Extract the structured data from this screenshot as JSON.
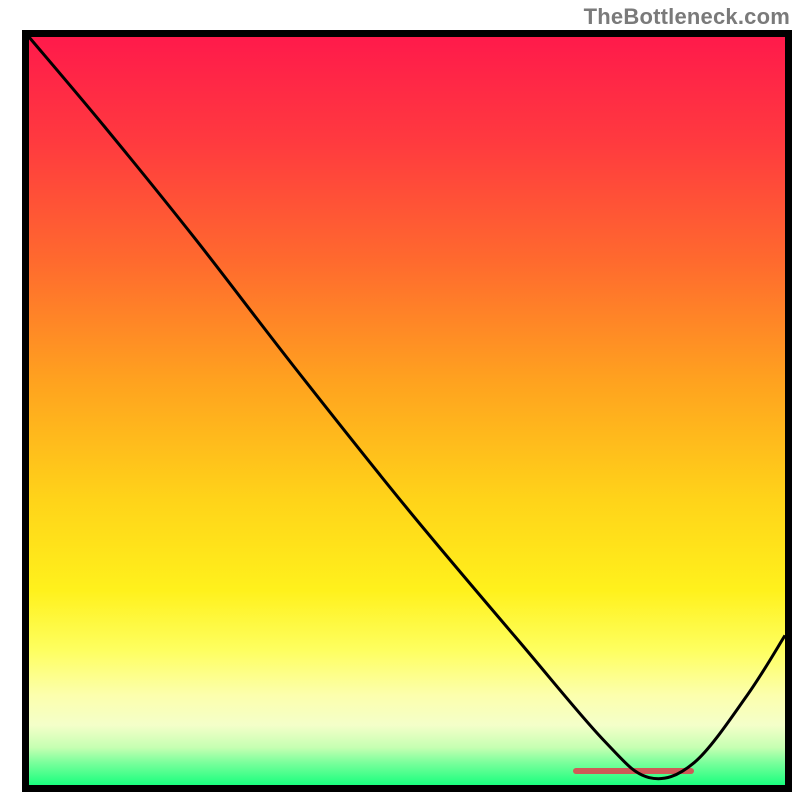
{
  "watermark": "TheBottleneck.com",
  "colors": {
    "frame_border": "#000000",
    "curve_stroke": "#000000",
    "marker": "#cf5a57"
  },
  "gradient": {
    "stops": [
      {
        "pct": 0,
        "color": "#ff1a4b"
      },
      {
        "pct": 14,
        "color": "#ff3a3f"
      },
      {
        "pct": 30,
        "color": "#ff6a2e"
      },
      {
        "pct": 46,
        "color": "#ffa21f"
      },
      {
        "pct": 62,
        "color": "#ffd419"
      },
      {
        "pct": 74,
        "color": "#fff11c"
      },
      {
        "pct": 82,
        "color": "#feff60"
      },
      {
        "pct": 88,
        "color": "#fcffad"
      },
      {
        "pct": 92,
        "color": "#f4ffc9"
      },
      {
        "pct": 95,
        "color": "#c6ffb2"
      },
      {
        "pct": 97,
        "color": "#7bff9c"
      },
      {
        "pct": 100,
        "color": "#1aff7e"
      }
    ]
  },
  "marker": {
    "x_left_pct": 72,
    "x_right_pct": 88,
    "y_pct": 98.5
  },
  "chart_data": {
    "type": "line",
    "title": "",
    "xlabel": "",
    "ylabel": "",
    "xlim": [
      0,
      100
    ],
    "ylim": [
      0,
      100
    ],
    "notes": "Background is a vertical red→yellow→green gradient. A single black curve descends from top-left, has a slight knee around x≈22, reaches a minimum near x≈82, then rises toward the right edge. A short reddish horizontal marker sits at the minimum.",
    "series": [
      {
        "name": "curve",
        "x": [
          0,
          10,
          22,
          35,
          50,
          65,
          76,
          82,
          88,
          95,
          100
        ],
        "y": [
          100,
          88,
          73,
          56,
          37,
          19,
          6,
          1,
          3,
          12,
          20
        ]
      }
    ],
    "annotations": [
      {
        "type": "marker-band",
        "x_start": 72,
        "x_end": 88,
        "y": 1.5,
        "color": "#cf5a57"
      }
    ]
  }
}
